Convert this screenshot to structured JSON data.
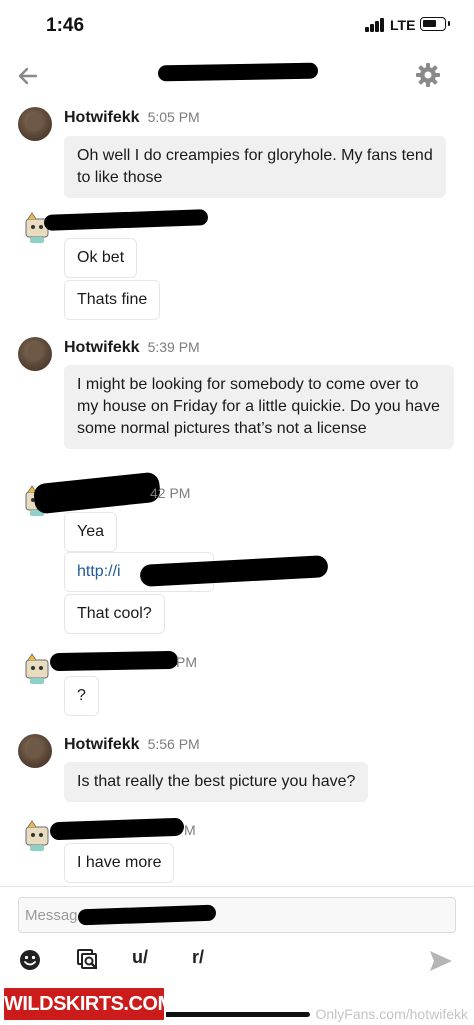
{
  "status_bar": {
    "time": "1:46",
    "network": "LTE"
  },
  "messages": [
    {
      "sender": "Hotwifekk",
      "time": "5:05 PM",
      "bubbles": [
        "Oh well I do creampies for gloryhole. My fans tend to like those"
      ]
    },
    {
      "bubbles": [
        "Ok bet",
        "Thats fine"
      ]
    },
    {
      "sender": "Hotwifekk",
      "time": "5:39 PM",
      "bubbles": [
        "I might be looking for somebody to come over to my house on Friday for a little quickie. Do you have some normal pictures that’s not a license"
      ]
    },
    {
      "time_partial": "42 PM",
      "bubbles": [
        "Yea",
        "http://i",
        "That cool?"
      ]
    },
    {
      "time_partial": "PM",
      "bubbles": [
        "?"
      ]
    },
    {
      "sender": "Hotwifekk",
      "time": "5:56 PM",
      "bubbles": [
        "Is that really the best picture you have?"
      ]
    },
    {
      "time_partial": "M",
      "bubbles": [
        "I have more"
      ]
    }
  ],
  "composer": {
    "placeholder": "Messag",
    "tools": [
      "u/",
      "r/"
    ]
  },
  "watermark": {
    "logo": "WILDSKIRTS.COM",
    "text": "OnlyFans.com/hotwifekk"
  },
  "colors": {
    "accent_link": "#1f5c99",
    "bubble_gray": "#f0f0f0",
    "timestamp": "#7c7c7c"
  }
}
